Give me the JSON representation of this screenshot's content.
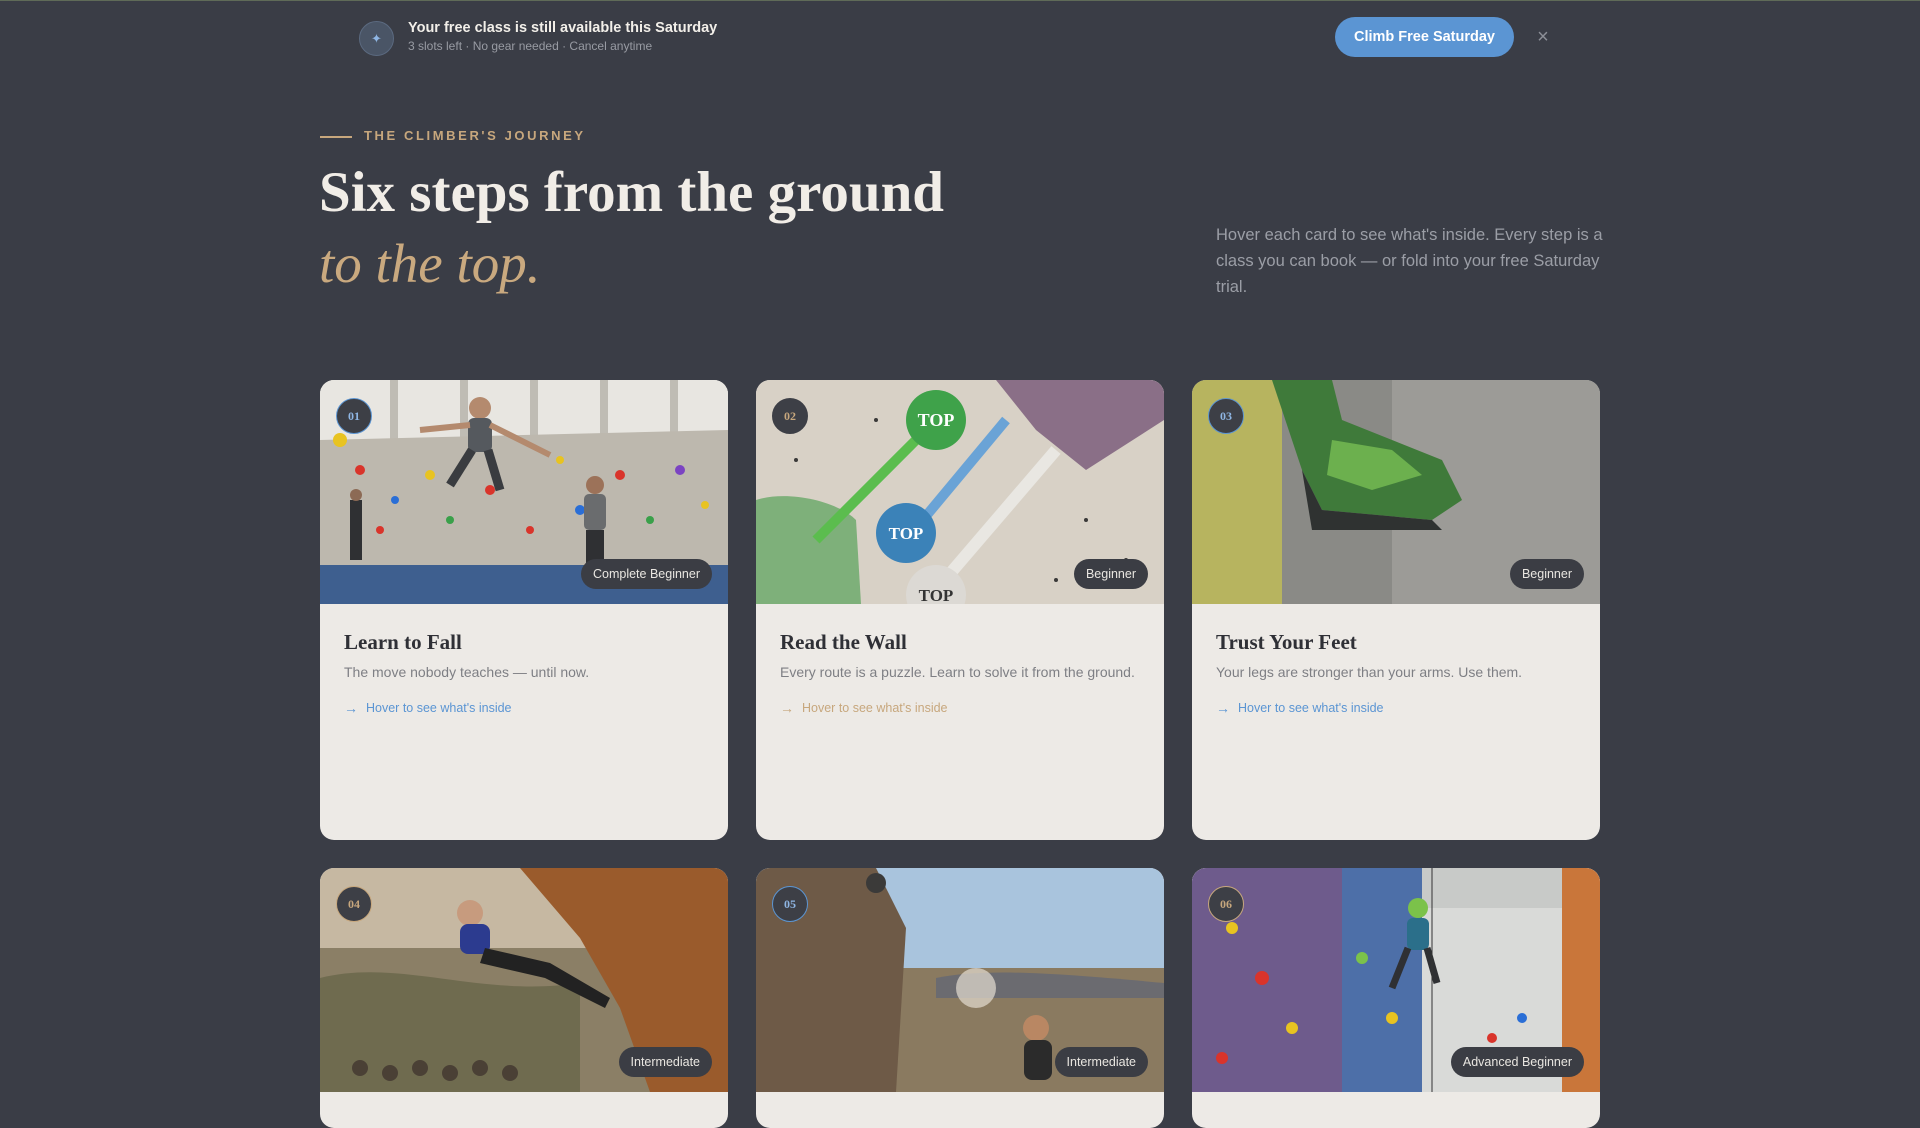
{
  "banner": {
    "title": "Your free class is still available this Saturday",
    "subtitle": "3 slots left · No gear needed · Cancel anytime",
    "cta": "Climb Free Saturday",
    "close": "×",
    "icon": "sparkle-icon"
  },
  "hero": {
    "eyebrow": "THE CLIMBER'S JOURNEY",
    "headline_line1": "Six steps from the ground",
    "headline_line2": "to the top.",
    "description": "Hover each card to see what's inside. Every step is a class you can book — or fold into your free Saturday trial."
  },
  "colors": {
    "accent_blue": "#5b95d3",
    "accent_gold": "#c7a77d",
    "background": "#3a3d46",
    "card": "#edeae6"
  },
  "cards": [
    {
      "number": "01",
      "level": "Complete Beginner",
      "title": "Learn to Fall",
      "description": "The move nobody teaches — until now.",
      "link": "Hover to see what's inside",
      "image": "indoor bouldering gym, climber jumping down onto mats"
    },
    {
      "number": "02",
      "level": "Beginner",
      "title": "Read the Wall",
      "description": "Every route is a puzzle. Learn to solve it from the ground.",
      "link": "Hover to see what's inside",
      "image": "climbing holds with route tape and TOP tags"
    },
    {
      "number": "03",
      "level": "Beginner",
      "title": "Trust Your Feet",
      "description": "Your legs are stronger than your arms. Use them.",
      "link": "Hover to see what's inside",
      "image": "close-up of climbing shoe on textured wall"
    },
    {
      "number": "04",
      "level": "Intermediate",
      "title": "",
      "description": "",
      "link": "",
      "image": "climber on outdoor boulder above a valley"
    },
    {
      "number": "05",
      "level": "Intermediate",
      "title": "",
      "description": "",
      "link": "",
      "image": "climbers on desert boulder with chalk"
    },
    {
      "number": "06",
      "level": "Advanced Beginner",
      "title": "",
      "description": "",
      "link": "",
      "image": "climber roped on indoor lead wall"
    }
  ]
}
